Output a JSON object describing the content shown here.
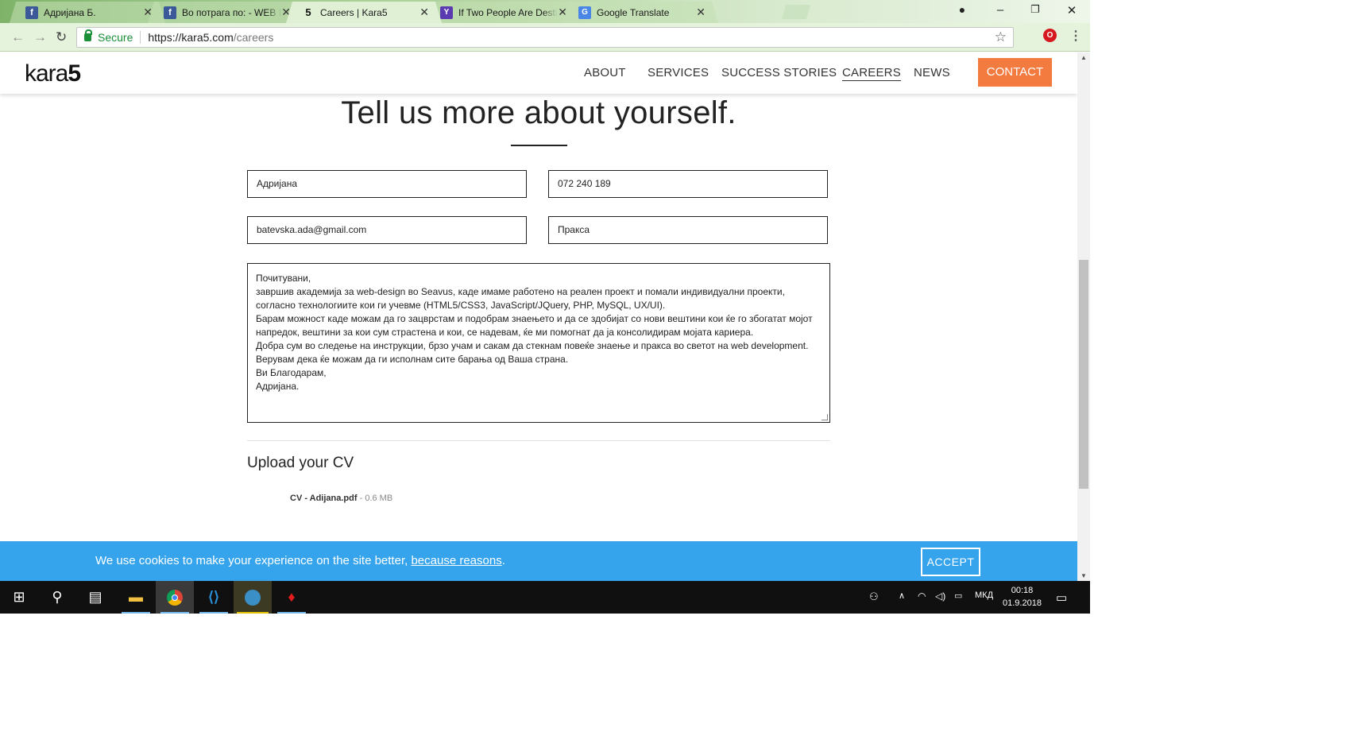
{
  "browser": {
    "tabs": [
      {
        "title": "Адријана Б.",
        "icon": "facebook-icon",
        "active": false
      },
      {
        "title": "Во потрага по: - WEB DE",
        "icon": "facebook-icon",
        "active": false
      },
      {
        "title": "Careers | Kara5",
        "icon": "kara5-favicon",
        "active": true
      },
      {
        "title": "If Two People Are Destin",
        "icon": "yahoo-icon",
        "active": false
      },
      {
        "title": "Google Translate",
        "icon": "google-translate-icon",
        "active": false
      }
    ],
    "address": {
      "secure_label": "Secure",
      "host": "https://kara5.com",
      "path": "/careers"
    }
  },
  "site": {
    "logo_text": "kara",
    "logo_bold": "5",
    "nav": [
      {
        "label": "ABOUT",
        "current": false
      },
      {
        "label": "SERVICES",
        "current": false
      },
      {
        "label": "SUCCESS STORIES",
        "current": false
      },
      {
        "label": "CAREERS",
        "current": true
      },
      {
        "label": "NEWS",
        "current": false
      }
    ],
    "contact_label": "CONTACT",
    "accent_color": "#f47b3f"
  },
  "form": {
    "heading": "Tell us more about yourself.",
    "name_value": "Адријана",
    "phone_value": "072 240 189",
    "email_value": "batevska.ada@gmail.com",
    "position_value": "Пракса",
    "message_lines": [
      "Почитувани,",
      "завршив академија за web-design во Seavus, каде имаме работено на реален проект и помали индивидуални проекти,",
      "согласно технологиите кои ги учевме (HTML5/CSS3, JavaScript/JQuery, PHP, MySQL, UX/UI).",
      "Барам можност каде можам да го зацврстам и подобрам знаењето и да се здобијат со нови вештини кои ќе го збогатат мојот",
      "напредок, вештини за кои сум страстена и кои, се надевам, ќе ми помогнат да ја консолидирам мојата кариера.",
      "Добра сум во следење на инструкции, брзо учам и сакам да стекнам повеќе знаење и пракса во светот на web development.",
      "Верувам дека ќе можам да ги исполнам сите барања од Ваша страна.",
      "Ви Благодарам,",
      "Адријана."
    ],
    "upload_title": "Upload your CV",
    "cv_filename": "CV - Adijana.pdf",
    "cv_size": " - 0.6 MB"
  },
  "cookie": {
    "text": "We use cookies to make your experience on the site better, ",
    "link": "because reasons",
    "trail": ".",
    "accept_label": "ACCEPT",
    "bar_color": "#35a4ec"
  },
  "taskbar": {
    "apps": [
      "windows-start-icon",
      "search-icon",
      "task-view-icon",
      "file-explorer-icon",
      "chrome-icon",
      "vscode-icon",
      "xampp-icon",
      "acrobat-icon"
    ],
    "language": "МКД",
    "time": "00:18",
    "date": "01.9.2018"
  }
}
